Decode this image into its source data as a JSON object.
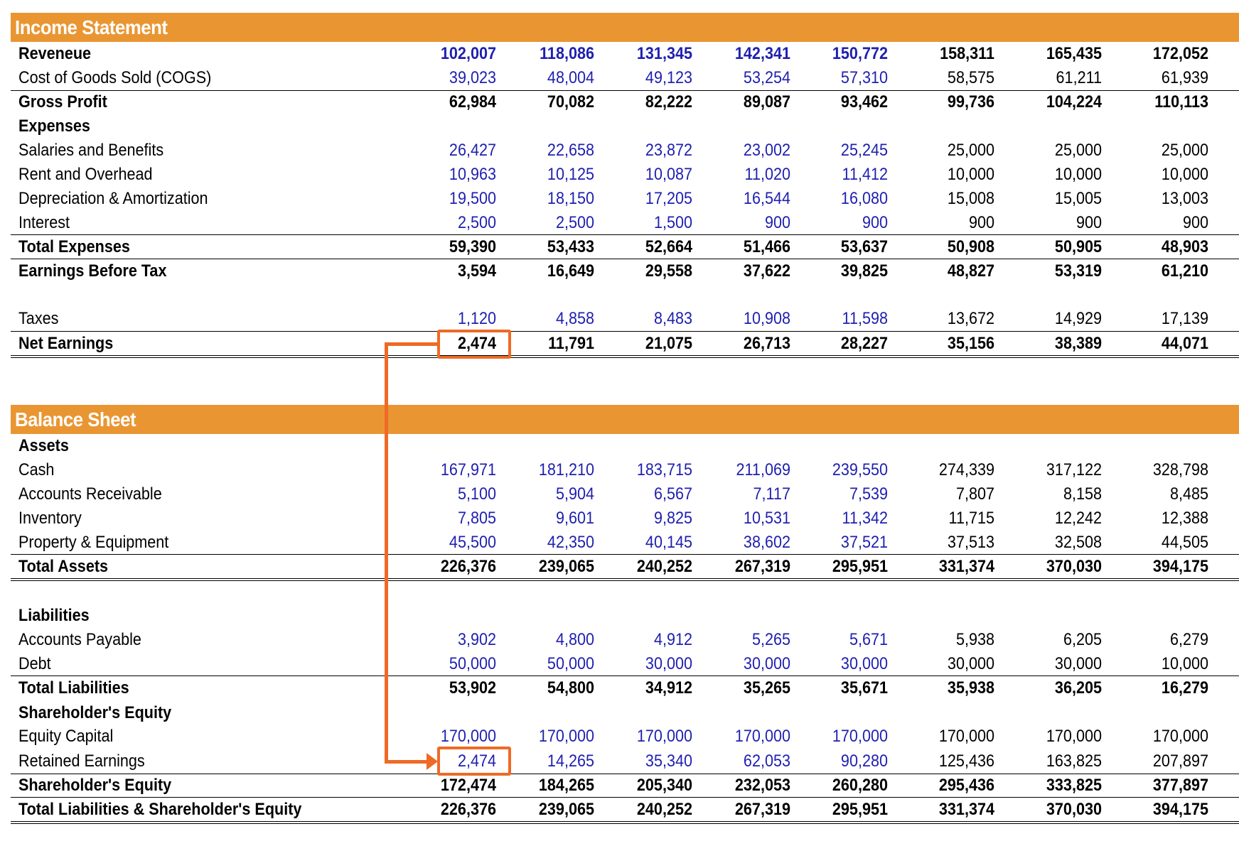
{
  "colors": {
    "header": "#E99632",
    "input_text": "#1F1FB0",
    "calc_text": "#000000",
    "highlight": "#EE6A25"
  },
  "income_statement": {
    "title": "Income Statement",
    "rows": [
      {
        "label": "Reveneue",
        "bold": true,
        "values": [
          "102,007",
          "118,086",
          "131,345",
          "142,341",
          "150,772",
          "158,311",
          "165,435",
          "172,052"
        ],
        "input_cols": 5
      },
      {
        "label": "Cost of Goods Sold (COGS)",
        "bold": false,
        "values": [
          "39,023",
          "48,004",
          "49,123",
          "53,254",
          "57,310",
          "58,575",
          "61,211",
          "61,939"
        ],
        "input_cols": 5
      },
      {
        "label": "Gross Profit",
        "bold": true,
        "values": [
          "62,984",
          "70,082",
          "82,222",
          "89,087",
          "93,462",
          "99,736",
          "104,224",
          "110,113"
        ],
        "input_cols": 0
      },
      {
        "label": "Expenses",
        "bold": true,
        "values": [],
        "input_cols": 0
      },
      {
        "label": "Salaries and Benefits",
        "bold": false,
        "values": [
          "26,427",
          "22,658",
          "23,872",
          "23,002",
          "25,245",
          "25,000",
          "25,000",
          "25,000"
        ],
        "input_cols": 5
      },
      {
        "label": "Rent and Overhead",
        "bold": false,
        "values": [
          "10,963",
          "10,125",
          "10,087",
          "11,020",
          "11,412",
          "10,000",
          "10,000",
          "10,000"
        ],
        "input_cols": 5
      },
      {
        "label": "Depreciation & Amortization",
        "bold": false,
        "values": [
          "19,500",
          "18,150",
          "17,205",
          "16,544",
          "16,080",
          "15,008",
          "15,005",
          "13,003"
        ],
        "input_cols": 5
      },
      {
        "label": "Interest",
        "bold": false,
        "values": [
          "2,500",
          "2,500",
          "1,500",
          "900",
          "900",
          "900",
          "900",
          "900"
        ],
        "input_cols": 5
      },
      {
        "label": "Total Expenses",
        "bold": true,
        "values": [
          "59,390",
          "53,433",
          "52,664",
          "51,466",
          "53,637",
          "50,908",
          "50,905",
          "48,903"
        ],
        "input_cols": 0
      },
      {
        "label": "Earnings Before Tax",
        "bold": true,
        "values": [
          "3,594",
          "16,649",
          "29,558",
          "37,622",
          "39,825",
          "48,827",
          "53,319",
          "61,210"
        ],
        "input_cols": 0
      },
      {
        "label": "Taxes",
        "bold": false,
        "values": [
          "1,120",
          "4,858",
          "8,483",
          "10,908",
          "11,598",
          "13,672",
          "14,929",
          "17,139"
        ],
        "input_cols": 5
      },
      {
        "label": "Net Earnings",
        "bold": true,
        "values": [
          "2,474",
          "11,791",
          "21,075",
          "26,713",
          "28,227",
          "35,156",
          "38,389",
          "44,071"
        ],
        "input_cols": 0
      }
    ]
  },
  "balance_sheet": {
    "title": "Balance Sheet",
    "rows": [
      {
        "label": "Assets",
        "bold": true,
        "values": [],
        "input_cols": 0
      },
      {
        "label": "Cash",
        "bold": false,
        "values": [
          "167,971",
          "181,210",
          "183,715",
          "211,069",
          "239,550",
          "274,339",
          "317,122",
          "328,798"
        ],
        "input_cols": 5
      },
      {
        "label": "Accounts Receivable",
        "bold": false,
        "values": [
          "5,100",
          "5,904",
          "6,567",
          "7,117",
          "7,539",
          "7,807",
          "8,158",
          "8,485"
        ],
        "input_cols": 5
      },
      {
        "label": "Inventory",
        "bold": false,
        "values": [
          "7,805",
          "9,601",
          "9,825",
          "10,531",
          "11,342",
          "11,715",
          "12,242",
          "12,388"
        ],
        "input_cols": 5
      },
      {
        "label": "Property & Equipment",
        "bold": false,
        "values": [
          "45,500",
          "42,350",
          "40,145",
          "38,602",
          "37,521",
          "37,513",
          "32,508",
          "44,505"
        ],
        "input_cols": 5
      },
      {
        "label": "Total Assets",
        "bold": true,
        "values": [
          "226,376",
          "239,065",
          "240,252",
          "267,319",
          "295,951",
          "331,374",
          "370,030",
          "394,175"
        ],
        "input_cols": 0
      },
      {
        "label": "Liabilities",
        "bold": true,
        "values": [],
        "input_cols": 0
      },
      {
        "label": "Accounts Payable",
        "bold": false,
        "values": [
          "3,902",
          "4,800",
          "4,912",
          "5,265",
          "5,671",
          "5,938",
          "6,205",
          "6,279"
        ],
        "input_cols": 5
      },
      {
        "label": "Debt",
        "bold": false,
        "values": [
          "50,000",
          "50,000",
          "30,000",
          "30,000",
          "30,000",
          "30,000",
          "30,000",
          "10,000"
        ],
        "input_cols": 5
      },
      {
        "label": "Total Liabilities",
        "bold": true,
        "values": [
          "53,902",
          "54,800",
          "34,912",
          "35,265",
          "35,671",
          "35,938",
          "36,205",
          "16,279"
        ],
        "input_cols": 0
      },
      {
        "label": "Shareholder's Equity",
        "bold": true,
        "values": [],
        "input_cols": 0
      },
      {
        "label": "Equity Capital",
        "bold": false,
        "values": [
          "170,000",
          "170,000",
          "170,000",
          "170,000",
          "170,000",
          "170,000",
          "170,000",
          "170,000"
        ],
        "input_cols": 5
      },
      {
        "label": "Retained Earnings",
        "bold": false,
        "values": [
          "2,474",
          "14,265",
          "35,340",
          "62,053",
          "90,280",
          "125,436",
          "163,825",
          "207,897"
        ],
        "input_cols": 5
      },
      {
        "label": "Shareholder's Equity",
        "bold": true,
        "values": [
          "172,474",
          "184,265",
          "205,340",
          "232,053",
          "260,280",
          "295,436",
          "333,825",
          "377,897"
        ],
        "input_cols": 0
      },
      {
        "label": "Total Liabilities & Shareholder's Equity",
        "bold": true,
        "values": [
          "226,376",
          "239,065",
          "240,252",
          "267,319",
          "295,951",
          "331,374",
          "370,030",
          "394,175"
        ],
        "input_cols": 0
      }
    ]
  },
  "annotation": {
    "description": "Net Earnings links to Retained Earnings",
    "from_value": "2,474",
    "to_value": "2,474"
  }
}
